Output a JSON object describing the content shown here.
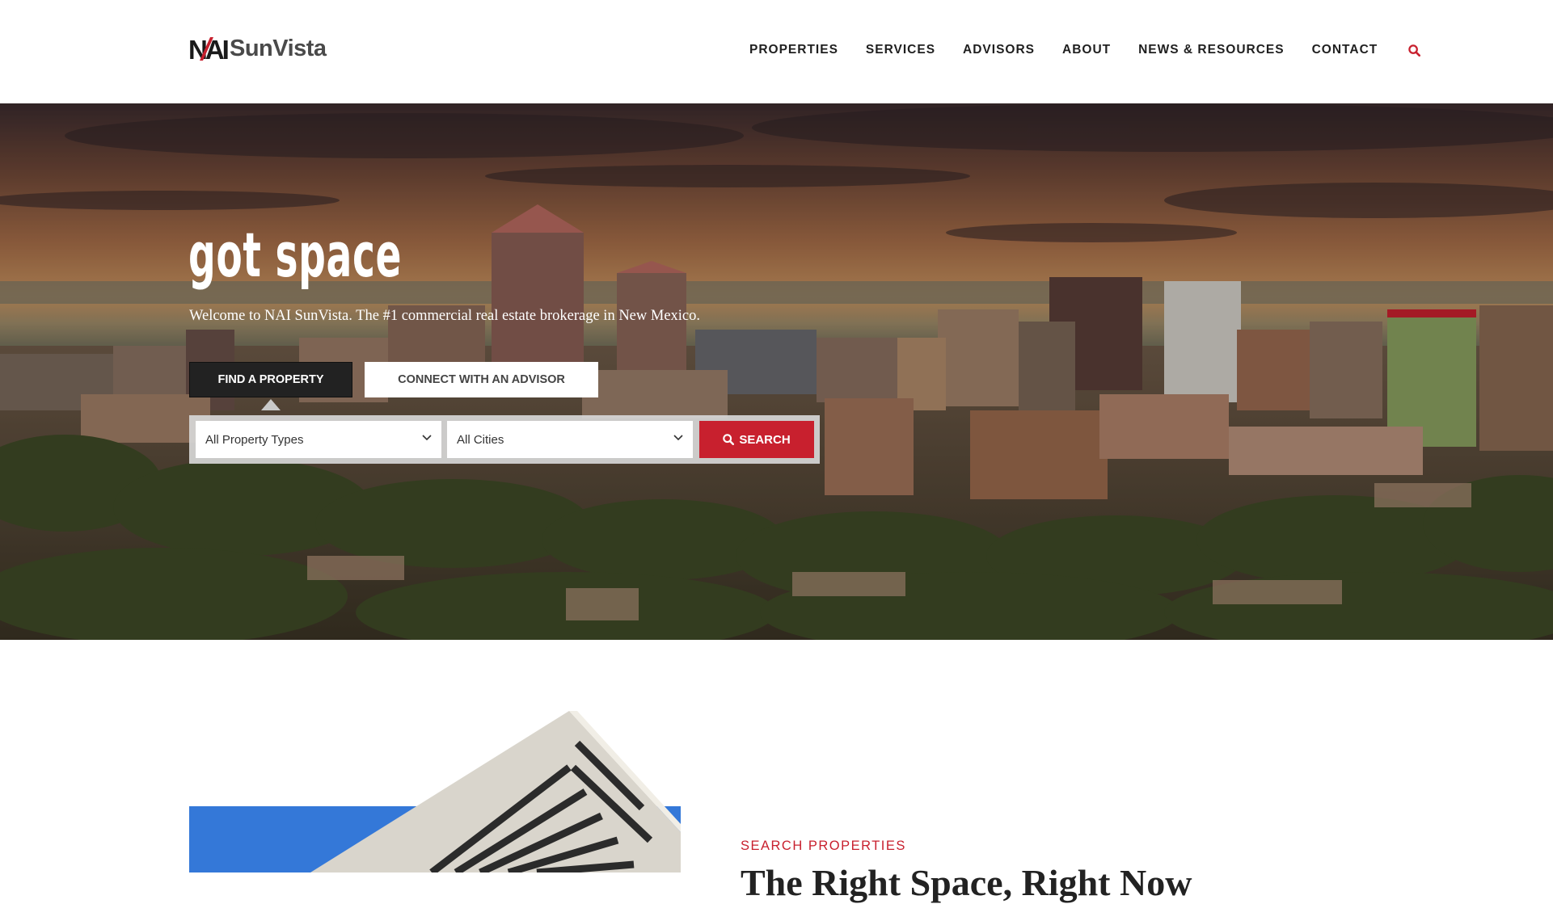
{
  "brand": {
    "logo_text": "SunVista",
    "logo_mark": "NAI",
    "accent_color": "#c8202e",
    "dark_color": "#222222"
  },
  "nav": {
    "items": [
      {
        "label": "PROPERTIES"
      },
      {
        "label": "SERVICES"
      },
      {
        "label": "ADVISORS"
      },
      {
        "label": "ABOUT"
      },
      {
        "label": "NEWS & RESOURCES"
      },
      {
        "label": "CONTACT"
      }
    ],
    "search_icon": "search-icon"
  },
  "hero": {
    "title": "got space",
    "subtitle": "Welcome to NAI SunVista. The #1 commercial real estate brokerage in New Mexico.",
    "tabs": {
      "find": "FIND A PROPERTY",
      "connect": "CONNECT WITH AN ADVISOR"
    },
    "search": {
      "property_type": "All Property Types",
      "city": "All Cities",
      "button": "SEARCH"
    }
  },
  "section": {
    "eyebrow": "SEARCH PROPERTIES",
    "heading": "The Right Space, Right Now"
  }
}
